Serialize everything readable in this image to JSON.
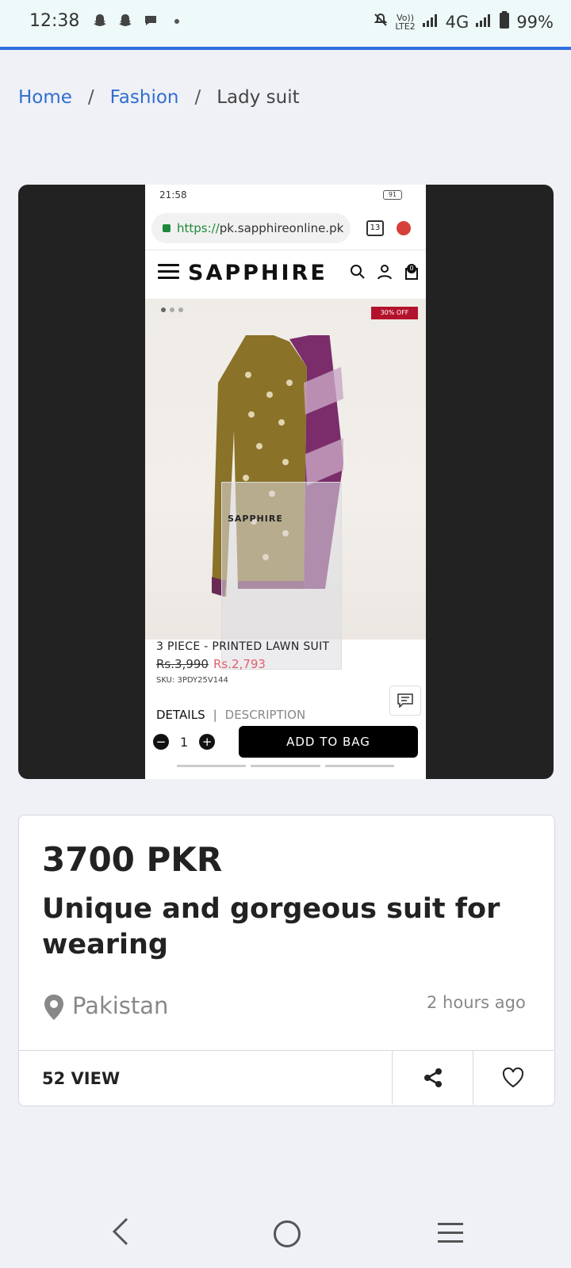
{
  "status_bar": {
    "time": "12:38",
    "notifications": [
      "snapchat-icon",
      "snapchat-icon",
      "chat-icon"
    ],
    "network_volte": "Vo))",
    "network_lte": "LTE2",
    "network_type": "4G",
    "battery": "99%"
  },
  "breadcrumb": {
    "home": "Home",
    "sep": "/",
    "category": "Fashion",
    "current": "Lady suit"
  },
  "screenshot": {
    "status_time": "21:58",
    "battery": "91",
    "url_scheme": "https://",
    "url_host": "pk.sapphireonline.pk",
    "tab_count": "13",
    "brand": "SAPPHIRE",
    "cart_count": "0",
    "discount_badge": "30% OFF",
    "product_title": "3 PIECE - PRINTED LAWN SUIT",
    "old_price": "Rs.3,990",
    "new_price": "Rs.2,793",
    "sku": "SKU: 3PDY25V144",
    "tab_details": "DETAILS",
    "tab_sep": "|",
    "tab_description": "DESCRIPTION",
    "quantity": "1",
    "add_to_bag": "ADD TO BAG"
  },
  "listing": {
    "price": "3700 PKR",
    "title": "Unique and gorgeous suit for wearing",
    "location": "Pakistan",
    "posted": "2 hours ago",
    "views": "52 VIEW"
  },
  "colors": {
    "accent": "#2f6fde",
    "link": "#2f6fd0",
    "sale": "#e0606d",
    "discount": "#b3122c"
  }
}
